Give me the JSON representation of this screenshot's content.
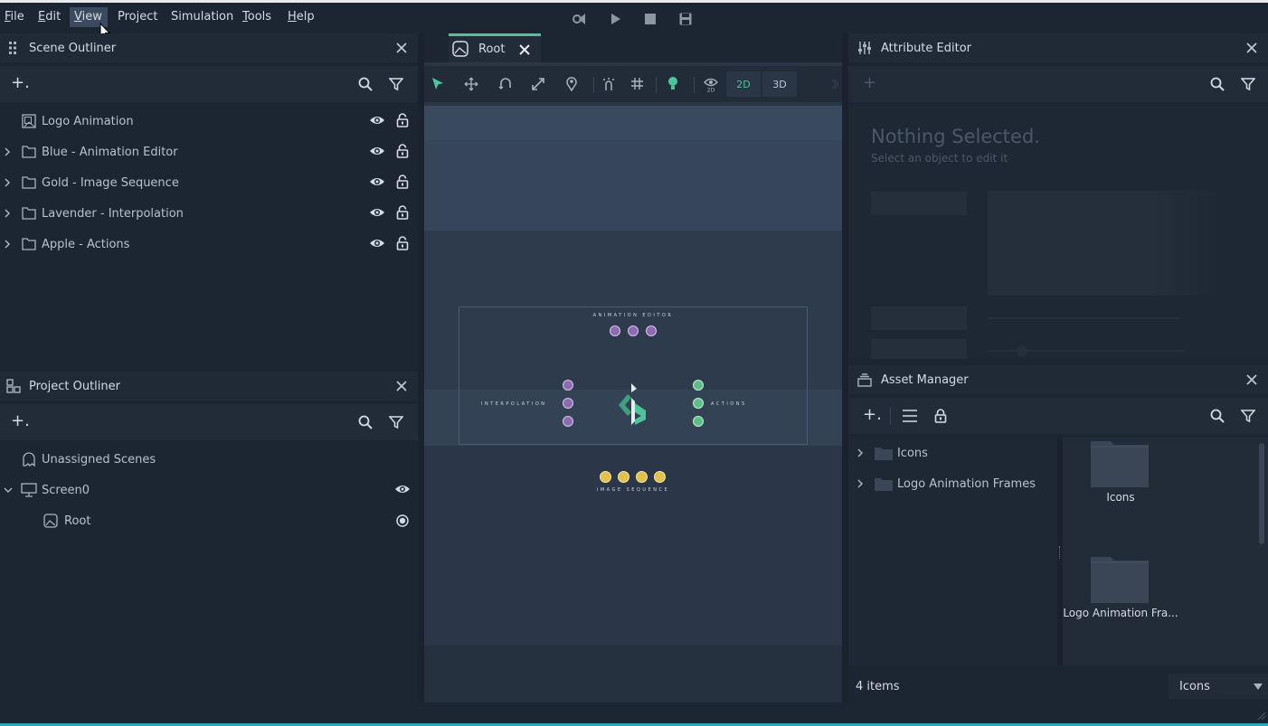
{
  "menubar": {
    "items": [
      {
        "label": "File",
        "ul": "F",
        "rest": "ile"
      },
      {
        "label": "Edit",
        "ul": "E",
        "rest": "dit"
      },
      {
        "label": "View",
        "ul": "V",
        "rest": "iew"
      },
      {
        "label": "Project",
        "ul": "",
        "rest": "Project"
      },
      {
        "label": "Simulation",
        "ul": "",
        "rest": "Simulation"
      },
      {
        "label": "Tools",
        "ul": "T",
        "rest": "ools"
      },
      {
        "label": "Help",
        "ul": "H",
        "rest": "elp"
      }
    ]
  },
  "scene_outliner": {
    "title": "Scene Outliner",
    "add_label": "+.",
    "items": [
      {
        "label": "Logo Animation"
      },
      {
        "label": "Blue - Animation Editor"
      },
      {
        "label": "Gold - Image Sequence"
      },
      {
        "label": "Lavender - Interpolation"
      },
      {
        "label": "Apple - Actions"
      }
    ]
  },
  "project_outliner": {
    "title": "Project Outliner",
    "add_label": "+.",
    "items": [
      {
        "label": "Unassigned Scenes"
      },
      {
        "label": "Screen0"
      },
      {
        "label": "Root"
      }
    ]
  },
  "viewport": {
    "tab_label": "Root",
    "mode_2d": "2D",
    "mode_3d": "3D",
    "canvas": {
      "top_label": "ANIMATION EDITOR",
      "left_label": "INTERPOLATION",
      "right_label": "ACTIONS",
      "bottom_label": "IMAGE SEQUENCE"
    }
  },
  "attribute_editor": {
    "title": "Attribute Editor",
    "add_label": "+",
    "empty_title": "Nothing Selected.",
    "empty_subtitle": "Select an object to edit it"
  },
  "asset_manager": {
    "title": "Asset Manager",
    "add_label": "+.",
    "tree": [
      {
        "label": "Icons"
      },
      {
        "label": "Logo Animation Frames"
      }
    ],
    "grid": [
      {
        "label": "Icons"
      },
      {
        "label": "Logo Animation Fra..."
      }
    ],
    "item_count": "4 items",
    "view_mode": "Icons"
  },
  "colors": {
    "accent": "#4fc49a",
    "lavender": "#8e6bb0",
    "gold": "#e2c14a",
    "apple": "#5dbf86",
    "status_bar": "#2aa7b4"
  }
}
